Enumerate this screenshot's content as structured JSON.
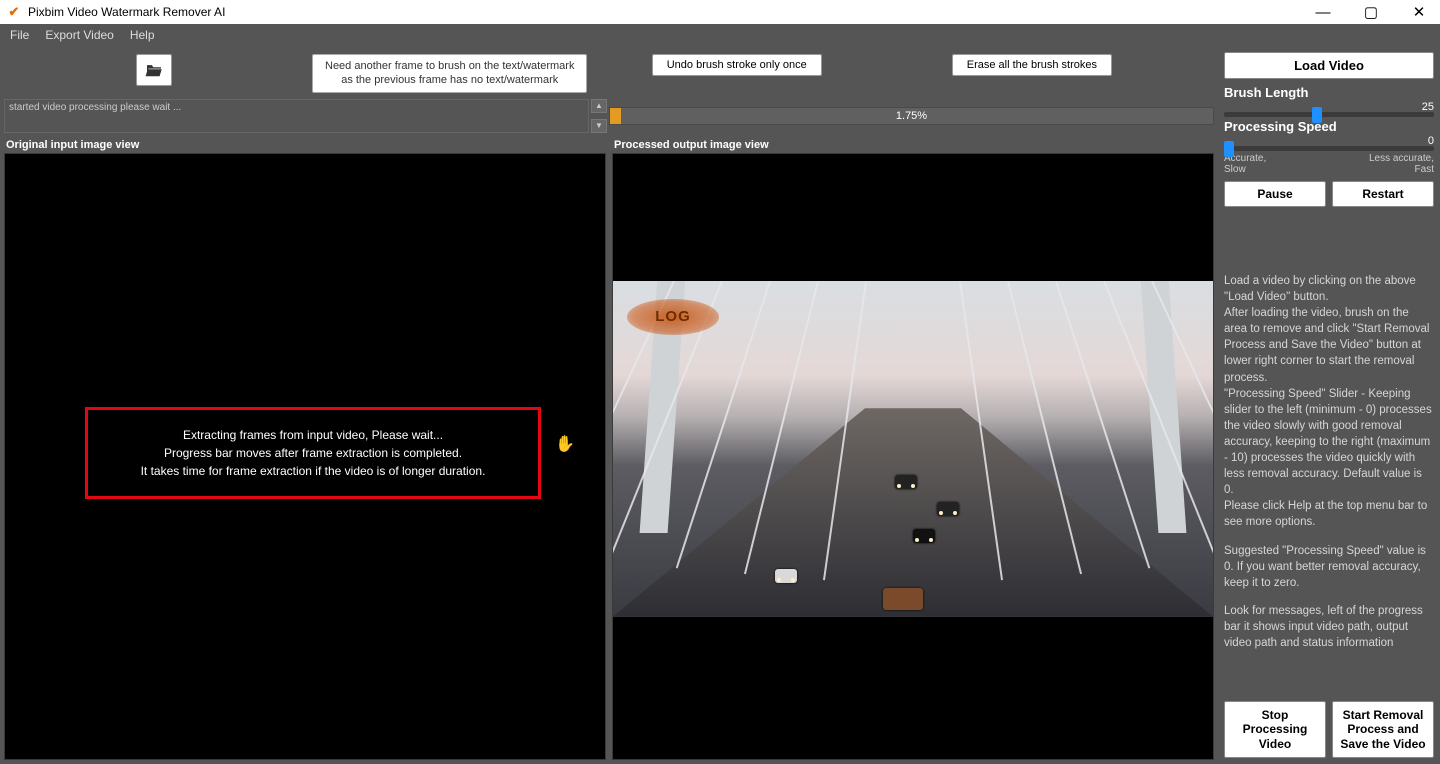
{
  "window": {
    "title": "Pixbim Video Watermark Remover AI"
  },
  "menu": {
    "file": "File",
    "export": "Export Video",
    "help": "Help"
  },
  "toolbar": {
    "hint_line1": "Need another frame to brush on the text/watermark",
    "hint_line2": "as the previous frame has no text/watermark",
    "undo": "Undo brush stroke only once",
    "erase": "Erase all the brush strokes"
  },
  "status": {
    "line1": "started video processing please wait ..."
  },
  "progress": {
    "percent_label": "1.75%",
    "percent_value": 1.75
  },
  "views": {
    "input_label": "Original input image view",
    "output_label": "Processed output image view"
  },
  "extract_message": {
    "l1": "Extracting frames from input video, Please wait...",
    "l2": "Progress bar moves after frame extraction is completed.",
    "l3": "It takes time for frame extraction if the video is of longer duration."
  },
  "watermark_text": "LOG",
  "sidebar": {
    "load_video": "Load Video",
    "brush_length_label": "Brush Length",
    "brush_length_value": "25",
    "processing_speed_label": "Processing Speed",
    "processing_speed_value": "0",
    "accurate_slow": "Accurate,\nSlow",
    "less_accurate_fast": "Less accurate,\nFast",
    "pause": "Pause",
    "restart": "Restart",
    "instructions_p1": "Load a video by clicking on the above \"Load Video\" button.\nAfter loading the video, brush on the area to remove and click \"Start Removal Process and Save the Video\" button at lower right corner to start the removal process.\n\"Processing Speed\" Slider - Keeping slider to the left (minimum - 0) processes the video slowly with good removal accuracy, keeping to the right (maximum - 10) processes the video quickly with less removal accuracy. Default value is 0.\nPlease click Help at the top menu bar to see more options.",
    "instructions_p2": "Suggested \"Processing Speed\" value is 0. If you want better removal accuracy, keep it to zero.",
    "instructions_p3": "Look for messages, left of the progress bar it shows input video path, output video path and status information",
    "stop": "Stop Processing Video",
    "start": "Start Removal Process and Save the Video"
  }
}
